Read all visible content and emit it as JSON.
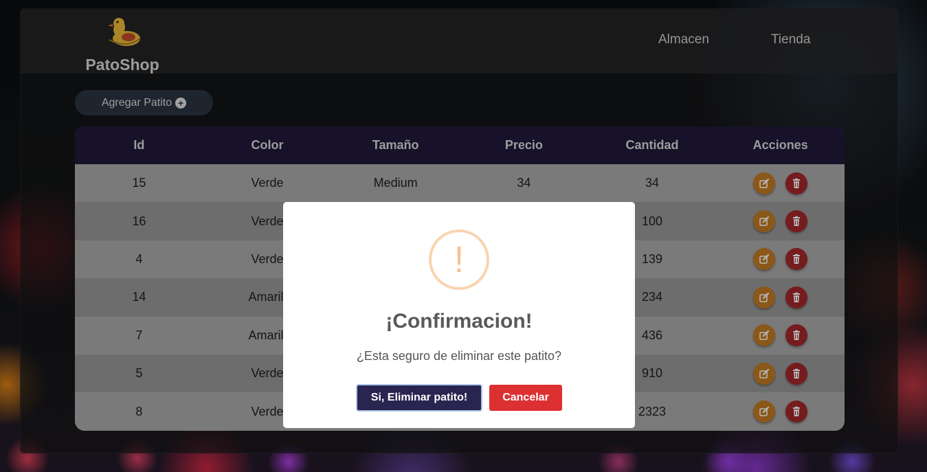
{
  "brand": {
    "name": "PatoShop",
    "logo_icon": "duck-icon"
  },
  "nav": {
    "items": [
      {
        "label": "Almacen"
      },
      {
        "label": "Tienda"
      }
    ]
  },
  "toolbar": {
    "add_label": "Agregar Patito",
    "add_icon": "plus-circle-icon"
  },
  "table": {
    "headers": [
      "Id",
      "Color",
      "Tamaño",
      "Precio",
      "Cantidad",
      "Acciones"
    ],
    "rows": [
      {
        "id": "15",
        "color": "Verde",
        "size": "Medium",
        "price": "34",
        "quantity": "34"
      },
      {
        "id": "16",
        "color": "Verde",
        "size": "",
        "price": "",
        "quantity": "100"
      },
      {
        "id": "4",
        "color": "Verde",
        "size": "",
        "price": "",
        "quantity": "139"
      },
      {
        "id": "14",
        "color": "Amarill",
        "size": "",
        "price": "",
        "quantity": "234"
      },
      {
        "id": "7",
        "color": "Amarill",
        "size": "",
        "price": "",
        "quantity": "436"
      },
      {
        "id": "5",
        "color": "Verde",
        "size": "",
        "price": "",
        "quantity": "910"
      },
      {
        "id": "8",
        "color": "Verde",
        "size": "",
        "price": "",
        "quantity": "2323"
      }
    ],
    "row_action_icons": [
      "edit-icon",
      "trash-icon"
    ]
  },
  "modal": {
    "icon": "!",
    "title": "¡Confirmacion!",
    "text": "¿Esta seguro de eliminar este patito?",
    "confirm_label": "Si, Eliminar patito!",
    "cancel_label": "Cancelar"
  },
  "colors": {
    "table_header": "#20193a",
    "edit_button": "#c17a23",
    "delete_button": "#a3282a",
    "confirm_button": "#2a2550",
    "cancel_button": "#dc3033",
    "warning_icon": "#f8d4b0"
  }
}
